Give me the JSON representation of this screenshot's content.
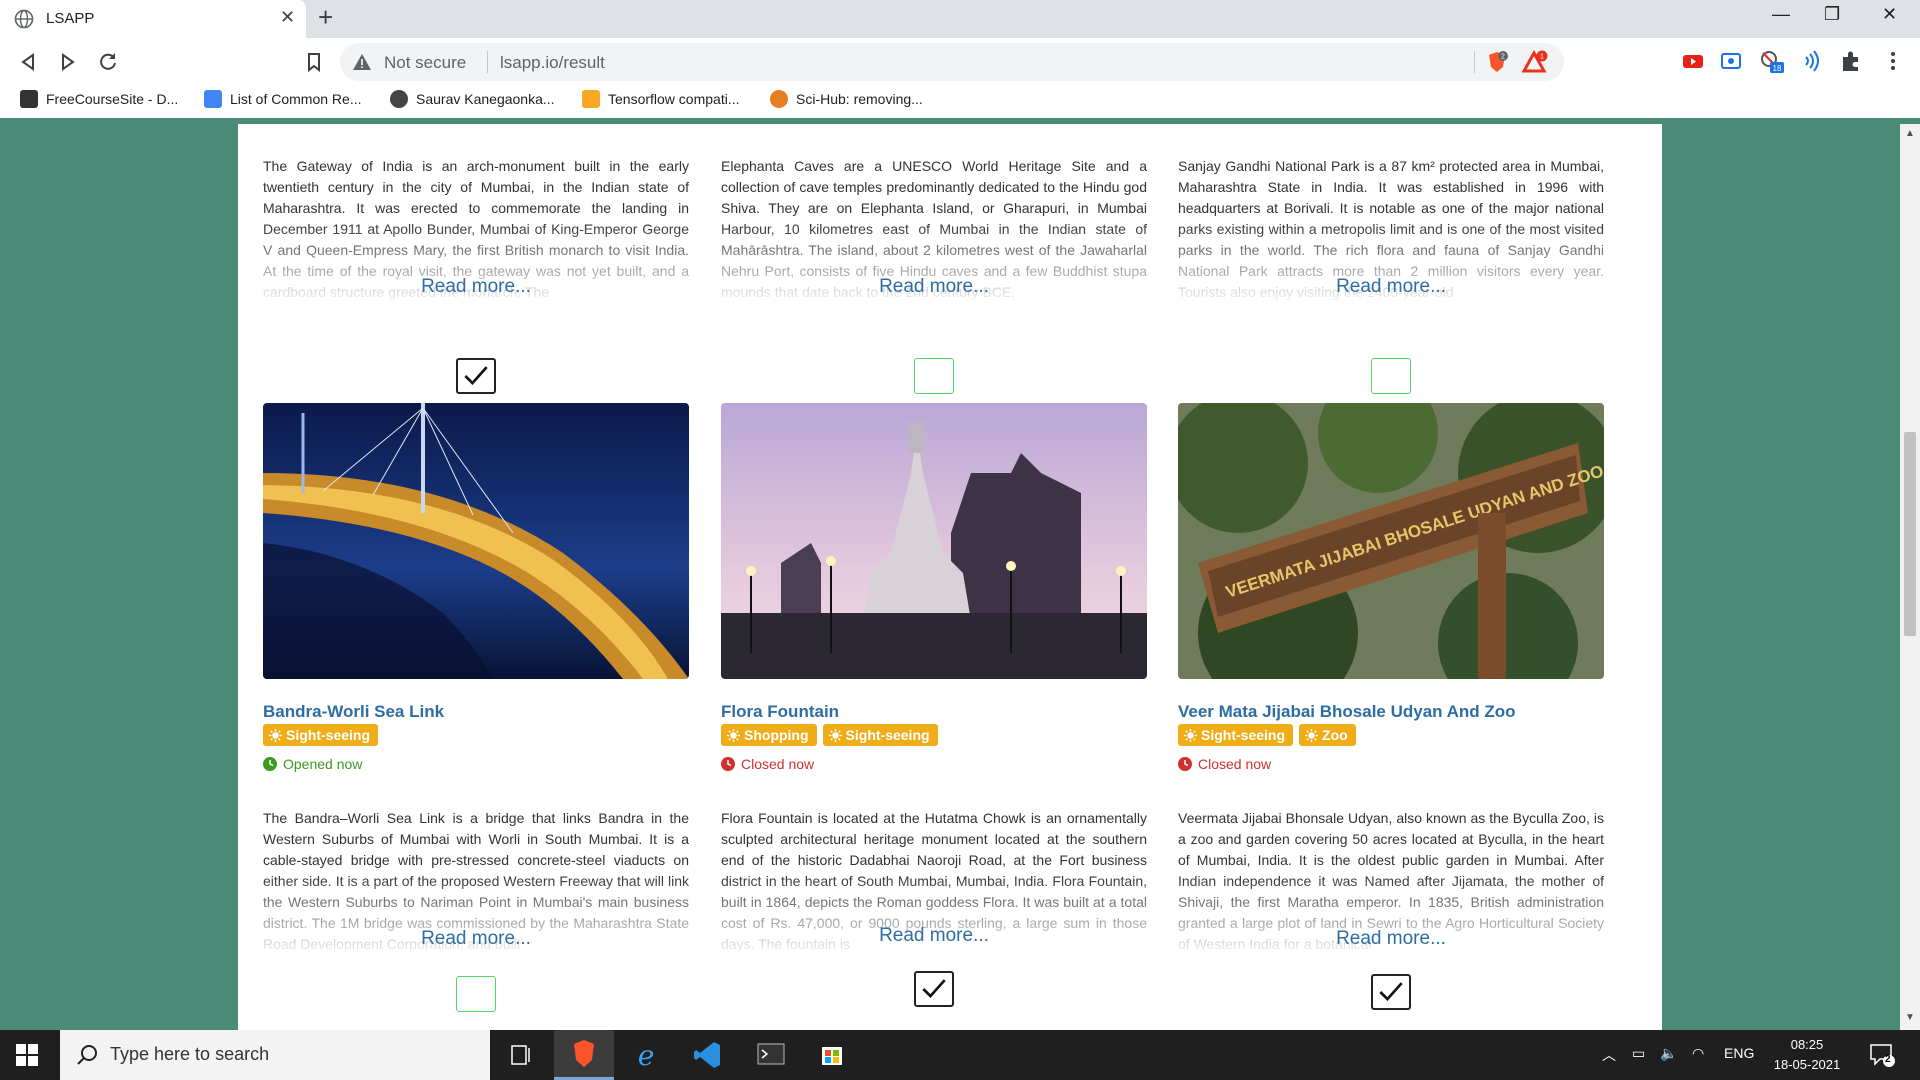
{
  "browser": {
    "tab_title": "LSAPP",
    "tab_close": "✕",
    "new_tab": "+",
    "window_min": "—",
    "window_restore": "❐",
    "window_close": "✕",
    "not_secure": "Not secure",
    "url": "lsapp.io/result",
    "brave_badge": "2",
    "rewards_badge": "1",
    "ext_badge": "18"
  },
  "bookmarks": [
    {
      "label": "FreeCourseSite - D...",
      "icon_color": "#333333"
    },
    {
      "label": "List of Common Re...",
      "icon_color": "#4285f4"
    },
    {
      "label": "Saurav Kanegaonka...",
      "icon_color": "#444444"
    },
    {
      "label": "Tensorflow compati...",
      "icon_color": "#f9a825"
    },
    {
      "label": "Sci-Hub: removing...",
      "icon_color": "#e67e22"
    }
  ],
  "read_more_label": "Read more...",
  "row1": [
    {
      "description": "The Gateway of India is an arch-monument built in the early twentieth century in the city of Mumbai, in the Indian state of Maharashtra. It was erected to commemorate the landing in December 1911 at Apollo Bunder, Mumbai of King-Emperor George V and Queen-Empress Mary, the first British monarch to visit India. At the time of the royal visit, the gateway was not yet built, and a cardboard structure greeted the monarch. The",
      "selected": true
    },
    {
      "description": "Elephanta Caves are a UNESCO World Heritage Site and a collection of cave temples predominantly dedicated to the Hindu god Shiva. They are on Elephanta Island, or Gharapuri, in Mumbai Harbour, 10 kilometres east of Mumbai in the Indian state of Mahārāshtra. The island, about 2 kilometres west of the Jawaharlal Nehru Port, consists of five Hindu caves and a few Buddhist stupa mounds that date back to the 2nd century BCE,",
      "selected": false
    },
    {
      "description": "Sanjay Gandhi National Park is a 87 km² protected area in Mumbai, Maharashtra State in India. It was established in 1996 with headquarters at Borivali. It is notable as one of the major national parks existing within a metropolis limit and is one of the most visited parks in the world. The rich flora and fauna of Sanjay Gandhi National Park attracts more than 2 million visitors every year. Tourists also enjoy visiting the 2400-year-old",
      "selected": false
    }
  ],
  "row2": [
    {
      "title": "Bandra-Worli Sea Link",
      "tags": [
        "Sight-seeing"
      ],
      "status": "Opened now",
      "status_color": "#3c9a1f",
      "description": "The Bandra–Worli Sea Link is a bridge that links Bandra in the Western Suburbs of Mumbai with Worli in South Mumbai. It is a cable-stayed bridge with pre-stressed concrete-steel viaducts on either side. It is a part of the proposed Western Freeway that will link the Western Suburbs to Nariman Point in Mumbai's main business district. The 1M bridge was commissioned by the Maharashtra State Road Development Corporation, and built",
      "selected": false
    },
    {
      "title": "Flora Fountain",
      "tags": [
        "Shopping",
        "Sight-seeing"
      ],
      "status": "Closed now",
      "status_color": "#d0312d",
      "description": "Flora Fountain is located at the Hutatma Chowk is an ornamentally sculpted architectural heritage monument located at the southern end of the historic Dadabhai Naoroji Road, at the Fort business district in the heart of South Mumbai, Mumbai, India. Flora Fountain, built in 1864, depicts the Roman goddess Flora. It was built at a total cost of Rs. 47,000, or 9000 pounds sterling, a large sum in those days. The fountain is",
      "selected": true
    },
    {
      "title": "Veer Mata Jijabai Bhosale Udyan And Zoo",
      "tags": [
        "Sight-seeing",
        "Zoo"
      ],
      "status": "Closed now",
      "status_color": "#d0312d",
      "sign_text": "VEERMATA JIJABAI BHOSALE UDYAN AND ZOO",
      "description": "Veermata Jijabai Bhonsale Udyan, also known as the Byculla Zoo, is a zoo and garden covering 50 acres located at Byculla, in the heart of Mumbai, India. It is the oldest public garden in Mumbai. After Indian independence it was Named after Jijamata, the mother of Shivaji, the first Maratha emperor. In 1835, British administration granted a large plot of land in Sewri to the Agro Horticultural Society of Western India for a botanical",
      "selected": true
    }
  ],
  "taskbar": {
    "search_placeholder": "Type here to search",
    "language": "ENG",
    "time": "08:25",
    "date": "18-05-2021",
    "notification_count": "2"
  }
}
